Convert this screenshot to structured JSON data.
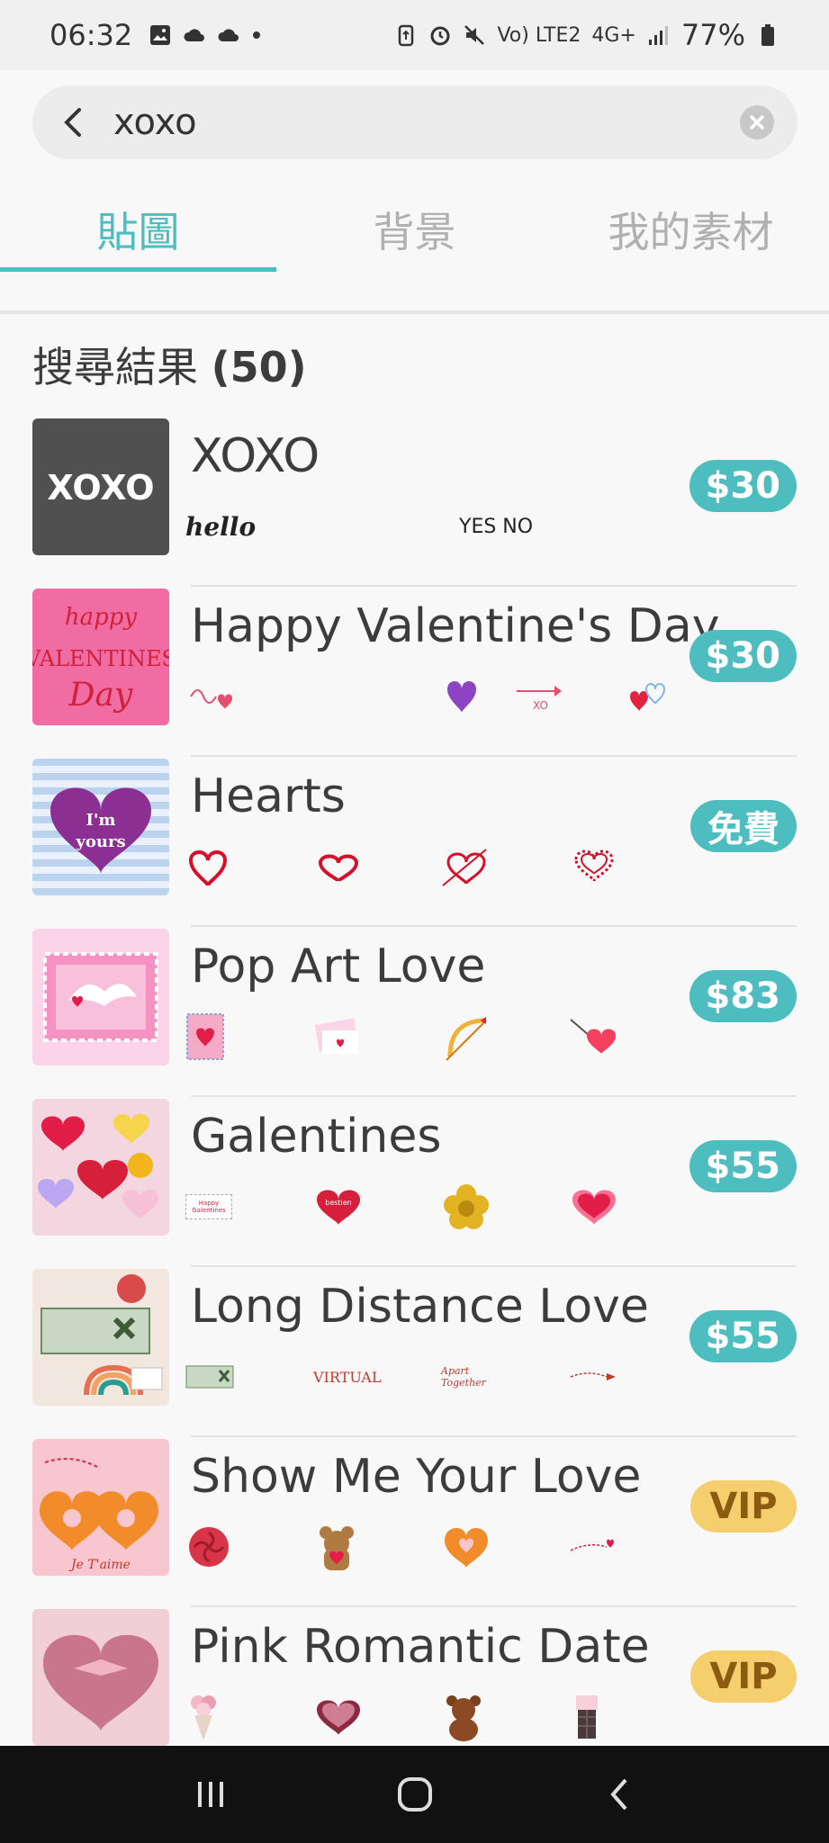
{
  "status_bar": {
    "time": "06:32",
    "signal_text": "Vo) LTE2",
    "network": "4G+",
    "battery": "77%"
  },
  "search": {
    "query": "xoxo"
  },
  "tabs": [
    {
      "label": "貼圖",
      "active": true
    },
    {
      "label": "背景",
      "active": false
    },
    {
      "label": "我的素材",
      "active": false
    }
  ],
  "results": {
    "title": "搜尋結果",
    "count": "(50)"
  },
  "items": [
    {
      "name": "XOXO",
      "price": "$30",
      "previews": [
        "hello",
        "",
        "YES NO",
        ""
      ]
    },
    {
      "name": "Happy Valentine's Day",
      "price": "$30",
      "previews": [
        "",
        "",
        "XO",
        ""
      ]
    },
    {
      "name": "Hearts",
      "price": "免費",
      "previews": [
        "",
        "",
        "",
        ""
      ]
    },
    {
      "name": "Pop Art Love",
      "price": "$83",
      "previews": [
        "",
        "",
        "",
        ""
      ]
    },
    {
      "name": "Galentines",
      "price": "$55",
      "previews": [
        "Happy Galentines",
        "bestien",
        "",
        ""
      ]
    },
    {
      "name": "Long Distance Love",
      "price": "$55",
      "previews": [
        "",
        "VIRTUAL",
        "Apart Together",
        ""
      ]
    },
    {
      "name": "Show Me Your Love",
      "price": "VIP",
      "previews": [
        "",
        "",
        "",
        ""
      ]
    },
    {
      "name": "Pink Romantic Date",
      "price": "VIP",
      "previews": [
        "",
        "",
        "",
        ""
      ]
    }
  ],
  "thumbnails": {
    "xoxo": "XOXO",
    "valentines_1": "happy",
    "valentines_2": "VALENTINES",
    "valentines_3": "Day",
    "hearts_1": "I'm",
    "hearts_2": "yours",
    "show_me": "Je T'aime"
  },
  "colors": {
    "accent": "#4dbdbf",
    "vip": "#f5cf6d",
    "text": "#3c3c3c"
  }
}
